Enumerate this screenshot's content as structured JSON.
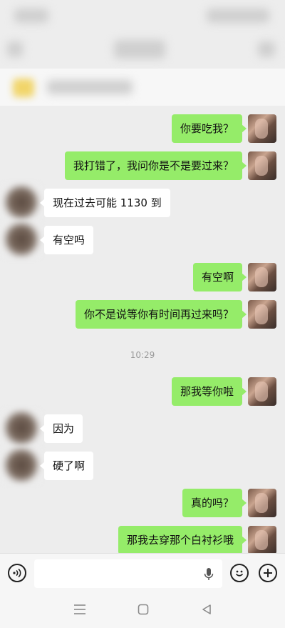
{
  "conversation": {
    "messages": [
      {
        "from": "me",
        "text": "你要吃我？"
      },
      {
        "from": "me",
        "text": "我打错了，我问你是不是要过来？"
      },
      {
        "from": "other",
        "text": "现在过去可能 1130 到"
      },
      {
        "from": "other",
        "text": "有空吗"
      },
      {
        "from": "me",
        "text": "有空啊"
      },
      {
        "from": "me",
        "text": "你不是说等你有时间再过来吗？"
      },
      {
        "from": "me",
        "text": "那我等你啦"
      },
      {
        "from": "other",
        "text": "因为"
      },
      {
        "from": "other",
        "text": "硬了啊"
      },
      {
        "from": "me",
        "text": "真的吗？"
      },
      {
        "from": "me",
        "text": "那我去穿那个白衬衫哦"
      }
    ],
    "timestamp": "10:29"
  },
  "colors": {
    "outgoing_bubble": "#95ec69",
    "incoming_bubble": "#ffffff",
    "background": "#ededed"
  },
  "input_bar": {
    "voice_icon": "voice-toggle-icon",
    "mic_icon": "microphone-icon",
    "emoji_icon": "emoji-icon",
    "plus_icon": "plus-icon"
  },
  "system_nav": {
    "menu_icon": "menu-icon",
    "home_icon": "home-icon",
    "back_icon": "back-icon"
  }
}
